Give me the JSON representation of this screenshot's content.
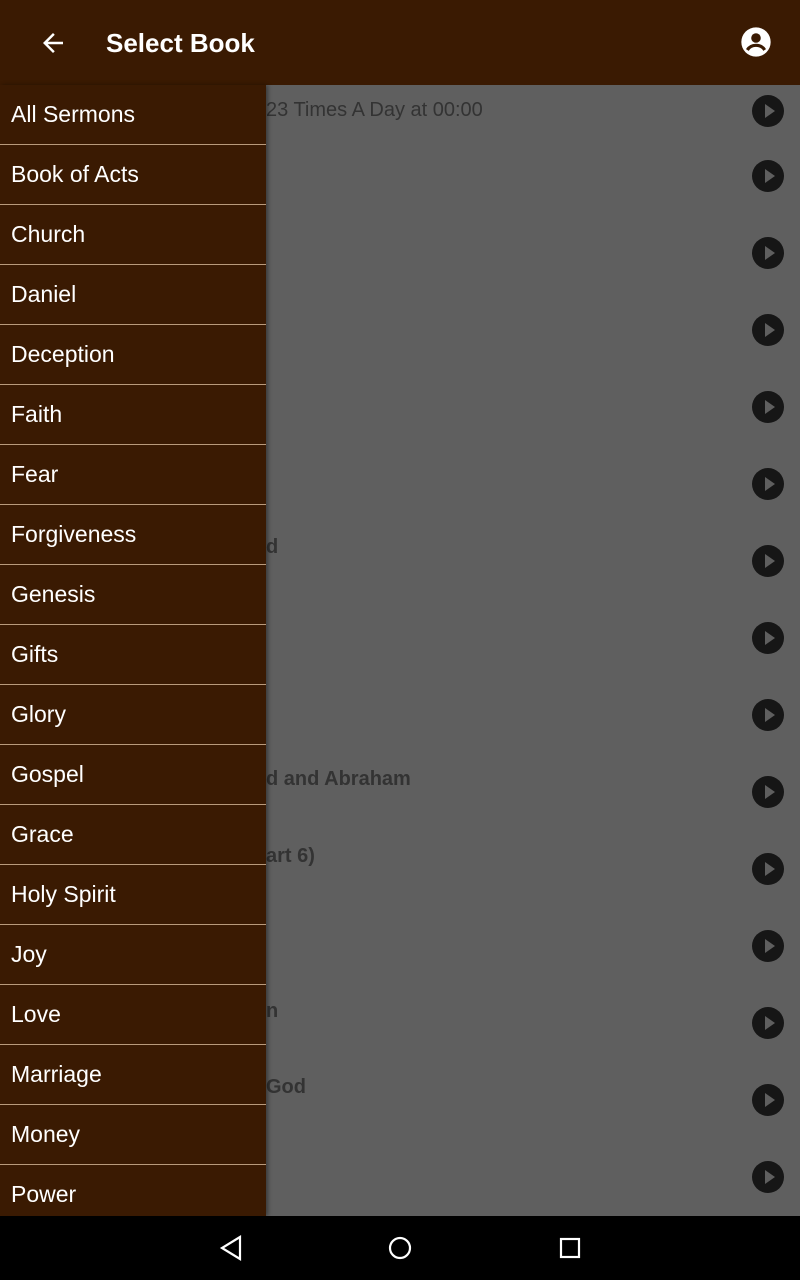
{
  "appbar": {
    "title": "Select Book"
  },
  "background_list": {
    "partial_texts": [
      {
        "text": "23 Times A Day at 00:00",
        "bold": false
      },
      {
        "text": "d",
        "bold": true
      },
      {
        "text": "d and Abraham",
        "bold": true
      },
      {
        "text": "art 6)",
        "bold": true
      },
      {
        "text": "n",
        "bold": true
      },
      {
        "text": "God",
        "bold": true
      }
    ]
  },
  "drawer": {
    "items": [
      "All Sermons",
      "Book of Acts",
      "Church",
      "Daniel",
      "Deception",
      "Faith",
      "Fear",
      "Forgiveness",
      "Genesis",
      "Gifts",
      "Glory",
      "Gospel",
      "Grace",
      "Holy Spirit",
      "Joy",
      "Love",
      "Marriage",
      "Money",
      "Power"
    ]
  },
  "colors": {
    "primary": "#3a1a02",
    "scrim": "#5f5f5f"
  }
}
